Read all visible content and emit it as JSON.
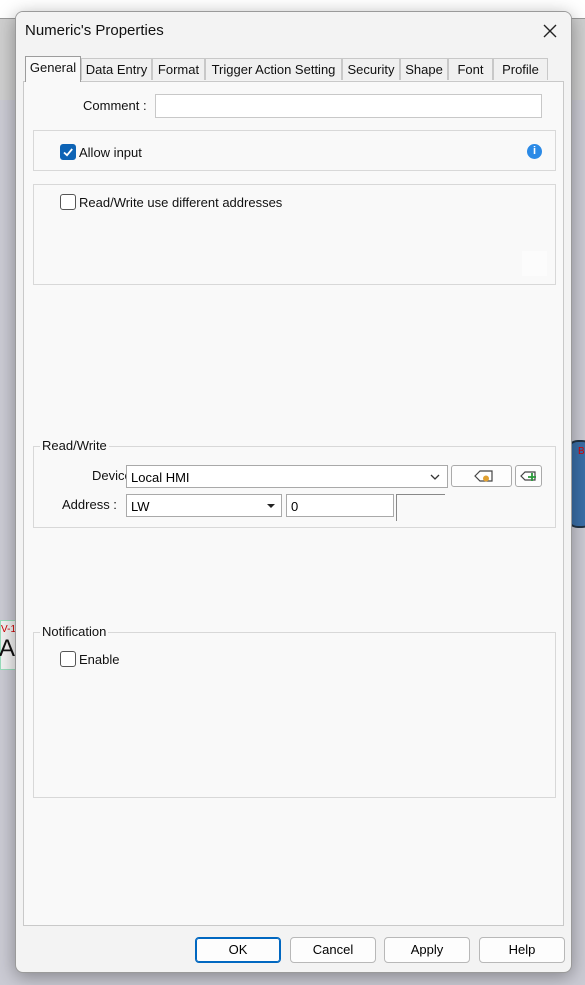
{
  "dialog": {
    "title": "Numeric's Properties"
  },
  "tabs": [
    {
      "label": "General",
      "active": true
    },
    {
      "label": "Data Entry"
    },
    {
      "label": "Format"
    },
    {
      "label": "Trigger Action Setting"
    },
    {
      "label": "Security"
    },
    {
      "label": "Shape"
    },
    {
      "label": "Font"
    },
    {
      "label": "Profile"
    }
  ],
  "general": {
    "comment_label": "Comment :",
    "comment_value": "",
    "allow_input_label": "Allow input",
    "allow_input_checked": true,
    "rw_different_label": "Read/Write use different addresses",
    "rw_different_checked": false
  },
  "read_write": {
    "group_label": "Read/Write",
    "device_label": "Device :",
    "device_value": "Local HMI",
    "address_label": "Address :",
    "address_type": "LW",
    "address_value": "0"
  },
  "notification": {
    "group_label": "Notification",
    "enable_label": "Enable",
    "enable_checked": false
  },
  "footer": {
    "ok": "OK",
    "cancel": "Cancel",
    "apply": "Apply",
    "help": "Help"
  },
  "colors": {
    "accent": "#0d63b5",
    "info": "#2b8ae6"
  },
  "icons": {
    "close": "close-icon",
    "check": "check-icon",
    "info": "info-icon",
    "tag": "tag-icon",
    "add_tag": "add-tag-icon",
    "dropdown": "chevron-down-icon"
  }
}
